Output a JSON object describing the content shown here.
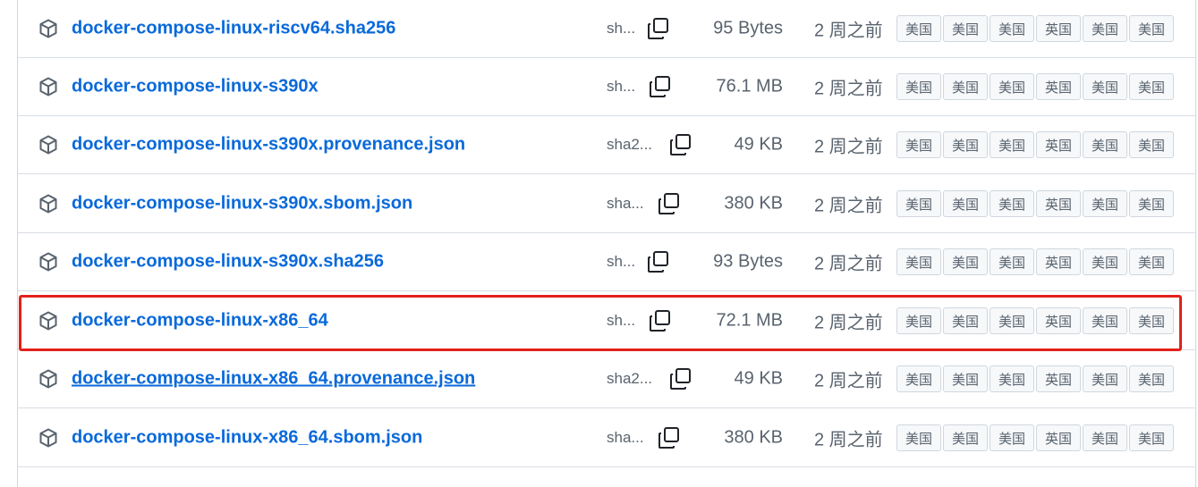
{
  "mirror_labels": [
    "美国",
    "美国",
    "美国",
    "英国",
    "美国",
    "美国"
  ],
  "assets": [
    {
      "name": "docker-compose-linux-riscv64.sha256",
      "sha": "sh...",
      "size": "95 Bytes",
      "date": "2 周之前"
    },
    {
      "name": "docker-compose-linux-s390x",
      "sha": "sh...",
      "size": "76.1 MB",
      "date": "2 周之前"
    },
    {
      "name": "docker-compose-linux-s390x.provenance.json",
      "sha": "sha2...",
      "size": "49 KB",
      "date": "2 周之前"
    },
    {
      "name": "docker-compose-linux-s390x.sbom.json",
      "sha": "sha...",
      "size": "380 KB",
      "date": "2 周之前"
    },
    {
      "name": "docker-compose-linux-s390x.sha256",
      "sha": "sh...",
      "size": "93 Bytes",
      "date": "2 周之前"
    },
    {
      "name": "docker-compose-linux-x86_64",
      "sha": "sh...",
      "size": "72.1 MB",
      "date": "2 周之前"
    },
    {
      "name": "docker-compose-linux-x86_64.provenance.json",
      "sha": "sha2...",
      "size": "49 KB",
      "date": "2 周之前"
    },
    {
      "name": "docker-compose-linux-x86_64.sbom.json",
      "sha": "sha...",
      "size": "380 KB",
      "date": "2 周之前"
    }
  ],
  "colors": {
    "link": "#0969da",
    "highlight": "#e3211b",
    "muted": "#59636e"
  }
}
